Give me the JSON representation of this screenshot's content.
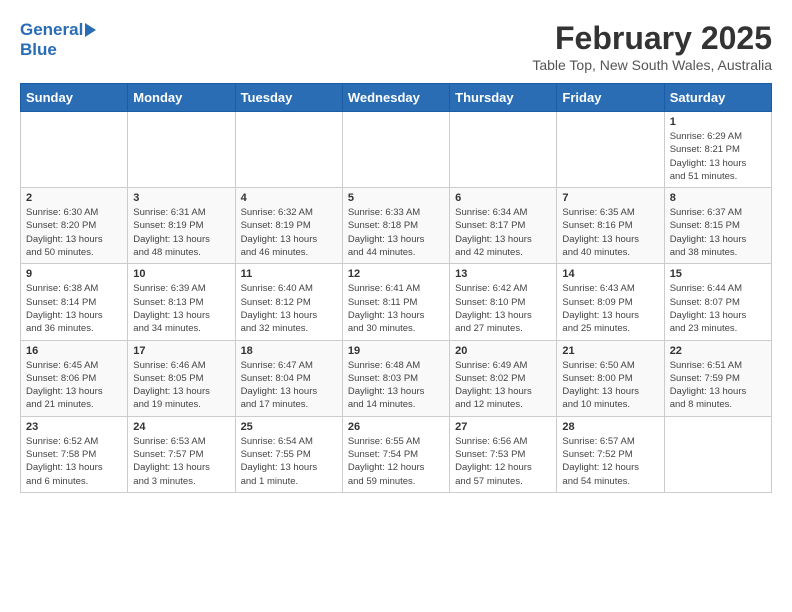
{
  "header": {
    "logo_general": "General",
    "logo_blue": "Blue",
    "title": "February 2025",
    "subtitle": "Table Top, New South Wales, Australia"
  },
  "weekdays": [
    "Sunday",
    "Monday",
    "Tuesday",
    "Wednesday",
    "Thursday",
    "Friday",
    "Saturday"
  ],
  "weeks": [
    [
      {
        "day": "",
        "info": ""
      },
      {
        "day": "",
        "info": ""
      },
      {
        "day": "",
        "info": ""
      },
      {
        "day": "",
        "info": ""
      },
      {
        "day": "",
        "info": ""
      },
      {
        "day": "",
        "info": ""
      },
      {
        "day": "1",
        "info": "Sunrise: 6:29 AM\nSunset: 8:21 PM\nDaylight: 13 hours\nand 51 minutes."
      }
    ],
    [
      {
        "day": "2",
        "info": "Sunrise: 6:30 AM\nSunset: 8:20 PM\nDaylight: 13 hours\nand 50 minutes."
      },
      {
        "day": "3",
        "info": "Sunrise: 6:31 AM\nSunset: 8:19 PM\nDaylight: 13 hours\nand 48 minutes."
      },
      {
        "day": "4",
        "info": "Sunrise: 6:32 AM\nSunset: 8:19 PM\nDaylight: 13 hours\nand 46 minutes."
      },
      {
        "day": "5",
        "info": "Sunrise: 6:33 AM\nSunset: 8:18 PM\nDaylight: 13 hours\nand 44 minutes."
      },
      {
        "day": "6",
        "info": "Sunrise: 6:34 AM\nSunset: 8:17 PM\nDaylight: 13 hours\nand 42 minutes."
      },
      {
        "day": "7",
        "info": "Sunrise: 6:35 AM\nSunset: 8:16 PM\nDaylight: 13 hours\nand 40 minutes."
      },
      {
        "day": "8",
        "info": "Sunrise: 6:37 AM\nSunset: 8:15 PM\nDaylight: 13 hours\nand 38 minutes."
      }
    ],
    [
      {
        "day": "9",
        "info": "Sunrise: 6:38 AM\nSunset: 8:14 PM\nDaylight: 13 hours\nand 36 minutes."
      },
      {
        "day": "10",
        "info": "Sunrise: 6:39 AM\nSunset: 8:13 PM\nDaylight: 13 hours\nand 34 minutes."
      },
      {
        "day": "11",
        "info": "Sunrise: 6:40 AM\nSunset: 8:12 PM\nDaylight: 13 hours\nand 32 minutes."
      },
      {
        "day": "12",
        "info": "Sunrise: 6:41 AM\nSunset: 8:11 PM\nDaylight: 13 hours\nand 30 minutes."
      },
      {
        "day": "13",
        "info": "Sunrise: 6:42 AM\nSunset: 8:10 PM\nDaylight: 13 hours\nand 27 minutes."
      },
      {
        "day": "14",
        "info": "Sunrise: 6:43 AM\nSunset: 8:09 PM\nDaylight: 13 hours\nand 25 minutes."
      },
      {
        "day": "15",
        "info": "Sunrise: 6:44 AM\nSunset: 8:07 PM\nDaylight: 13 hours\nand 23 minutes."
      }
    ],
    [
      {
        "day": "16",
        "info": "Sunrise: 6:45 AM\nSunset: 8:06 PM\nDaylight: 13 hours\nand 21 minutes."
      },
      {
        "day": "17",
        "info": "Sunrise: 6:46 AM\nSunset: 8:05 PM\nDaylight: 13 hours\nand 19 minutes."
      },
      {
        "day": "18",
        "info": "Sunrise: 6:47 AM\nSunset: 8:04 PM\nDaylight: 13 hours\nand 17 minutes."
      },
      {
        "day": "19",
        "info": "Sunrise: 6:48 AM\nSunset: 8:03 PM\nDaylight: 13 hours\nand 14 minutes."
      },
      {
        "day": "20",
        "info": "Sunrise: 6:49 AM\nSunset: 8:02 PM\nDaylight: 13 hours\nand 12 minutes."
      },
      {
        "day": "21",
        "info": "Sunrise: 6:50 AM\nSunset: 8:00 PM\nDaylight: 13 hours\nand 10 minutes."
      },
      {
        "day": "22",
        "info": "Sunrise: 6:51 AM\nSunset: 7:59 PM\nDaylight: 13 hours\nand 8 minutes."
      }
    ],
    [
      {
        "day": "23",
        "info": "Sunrise: 6:52 AM\nSunset: 7:58 PM\nDaylight: 13 hours\nand 6 minutes."
      },
      {
        "day": "24",
        "info": "Sunrise: 6:53 AM\nSunset: 7:57 PM\nDaylight: 13 hours\nand 3 minutes."
      },
      {
        "day": "25",
        "info": "Sunrise: 6:54 AM\nSunset: 7:55 PM\nDaylight: 13 hours\nand 1 minute."
      },
      {
        "day": "26",
        "info": "Sunrise: 6:55 AM\nSunset: 7:54 PM\nDaylight: 12 hours\nand 59 minutes."
      },
      {
        "day": "27",
        "info": "Sunrise: 6:56 AM\nSunset: 7:53 PM\nDaylight: 12 hours\nand 57 minutes."
      },
      {
        "day": "28",
        "info": "Sunrise: 6:57 AM\nSunset: 7:52 PM\nDaylight: 12 hours\nand 54 minutes."
      },
      {
        "day": "",
        "info": ""
      }
    ]
  ]
}
